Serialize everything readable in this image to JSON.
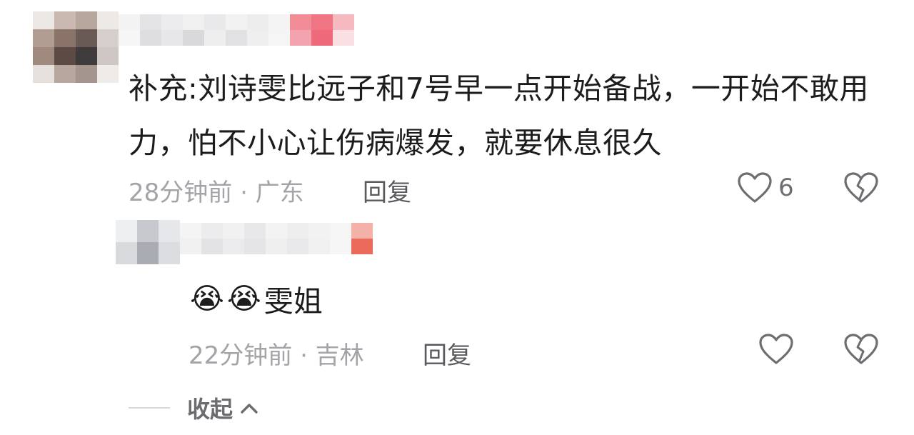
{
  "comment": {
    "text": "补充:刘诗雯比远子和7号早一点开始备战，一开始不敢用力，怕不小心让伤病爆发，就要休息很久",
    "time_location": "28分钟前 · 广东",
    "reply_label": "回复",
    "like_count": "6"
  },
  "reply": {
    "emoji": [
      "😭",
      "😭"
    ],
    "text": "雯姐",
    "time_location": "22分钟前 · 吉林",
    "reply_label": "回复"
  },
  "collapse": {
    "label": "收起"
  },
  "icons": {
    "like": "heart-outline-icon",
    "dislike": "broken-heart-icon",
    "collapse": "chevron-up-icon"
  },
  "colors": {
    "text": "#1c1c1e",
    "meta": "#a4a4a8",
    "icon": "#6d6d72",
    "blur_accent": "#f07080"
  }
}
